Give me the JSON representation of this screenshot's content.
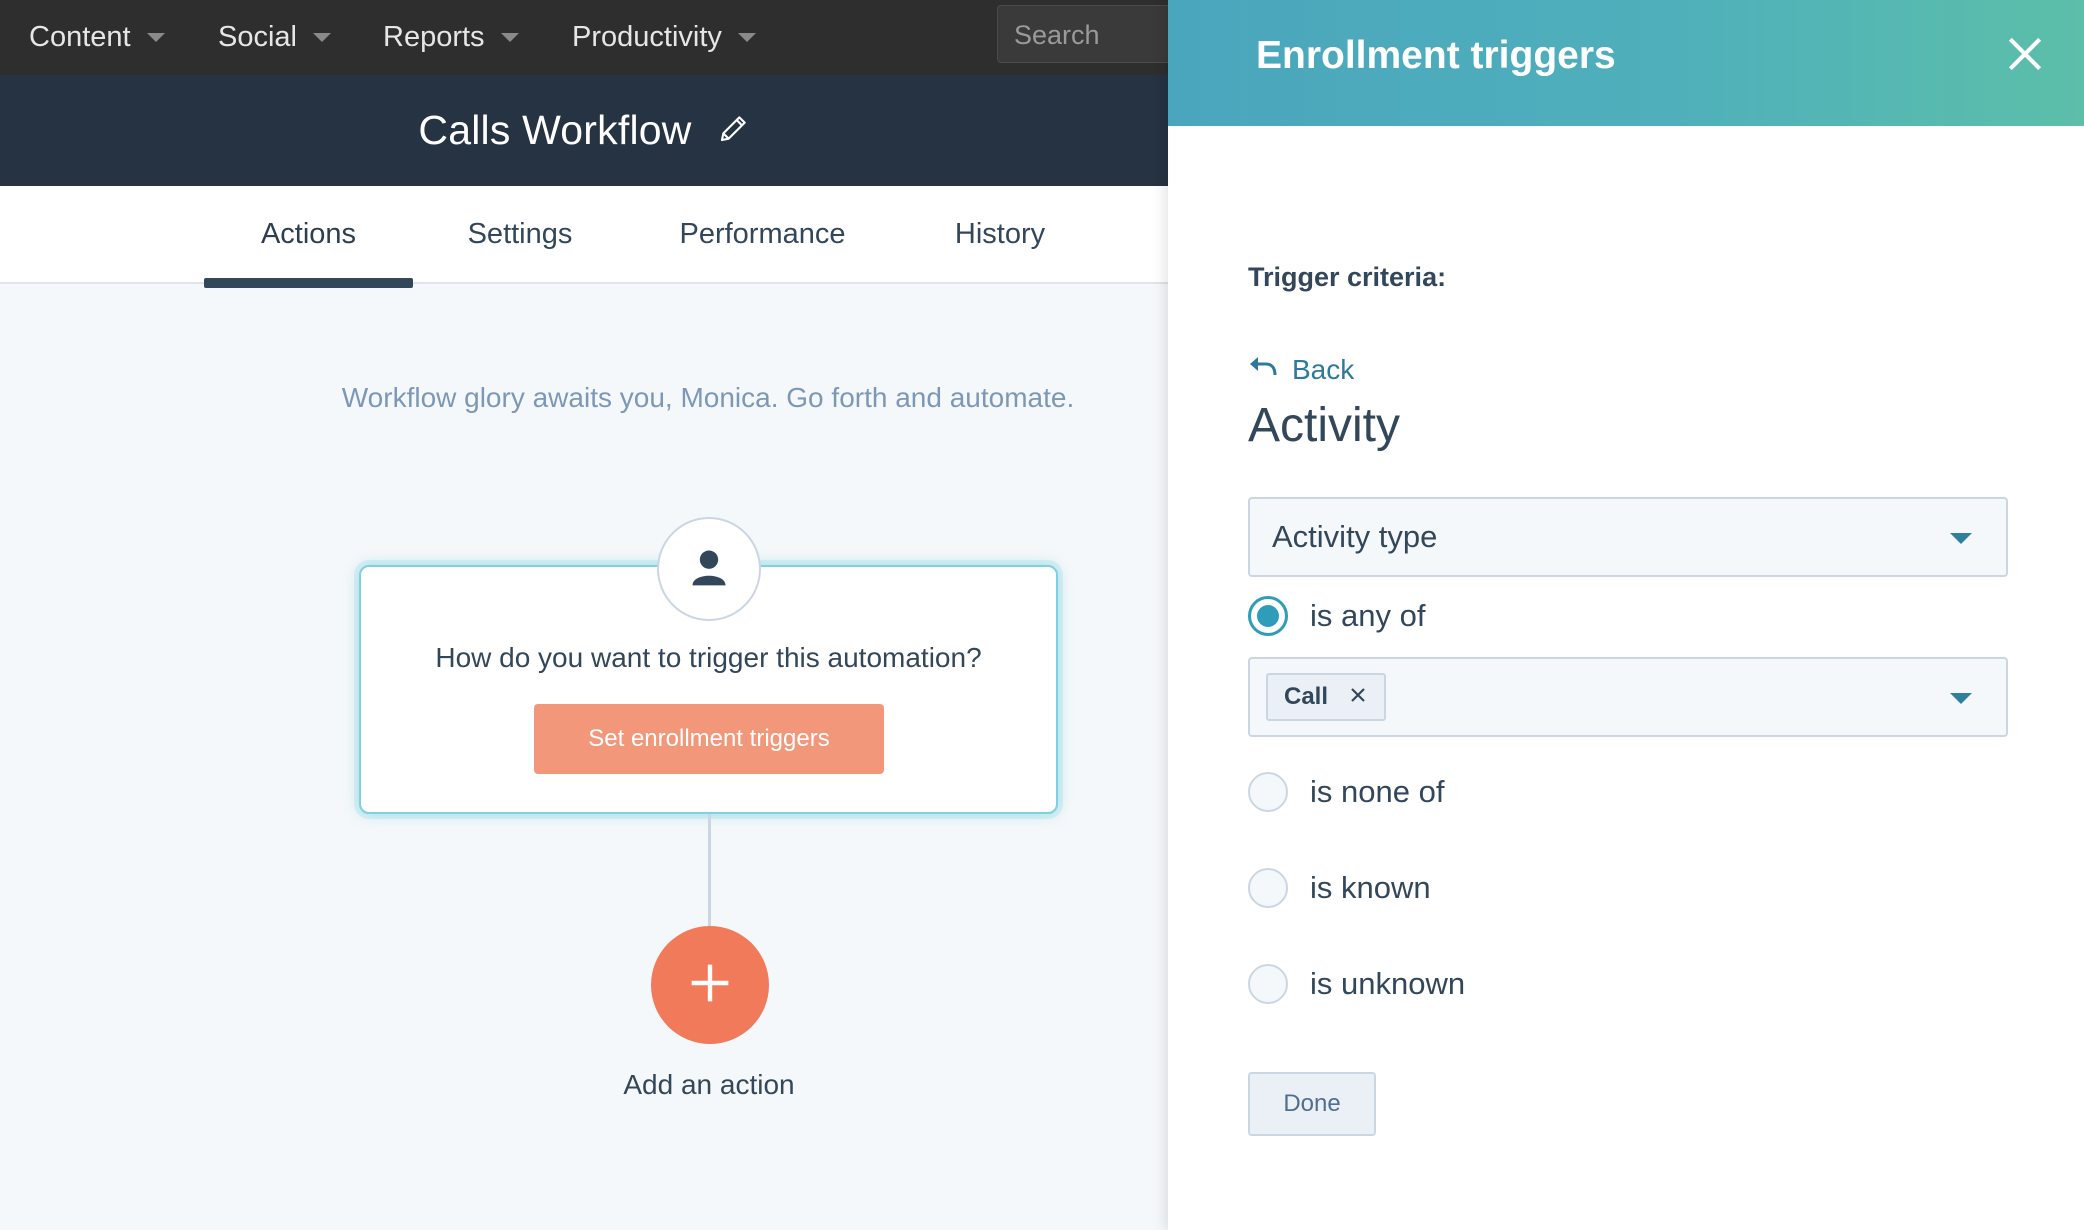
{
  "topnav": {
    "items": [
      {
        "label": "Content"
      },
      {
        "label": "Social"
      },
      {
        "label": "Reports"
      },
      {
        "label": "Productivity"
      }
    ],
    "search_placeholder": "Search"
  },
  "workflow": {
    "title": "Calls Workflow"
  },
  "tabs": [
    {
      "label": "Actions",
      "active": true
    },
    {
      "label": "Settings",
      "active": false
    },
    {
      "label": "Performance",
      "active": false
    },
    {
      "label": "History",
      "active": false
    }
  ],
  "canvas": {
    "greeting": "Workflow glory awaits you, Monica. Go forth and automate.",
    "trigger_question": "How do you want to trigger this automation?",
    "set_triggers_label": "Set enrollment triggers",
    "add_action_label": "Add an action"
  },
  "panel": {
    "title": "Enrollment triggers",
    "criteria_label": "Trigger criteria:",
    "back_label": "Back",
    "section_title": "Activity",
    "property_dropdown_value": "Activity type",
    "operators": [
      {
        "label": "is any of",
        "selected": true
      },
      {
        "label": "is none of",
        "selected": false
      },
      {
        "label": "is known",
        "selected": false
      },
      {
        "label": "is unknown",
        "selected": false
      }
    ],
    "selected_values": [
      "Call"
    ],
    "done_label": "Done"
  },
  "colors": {
    "nav_bg": "#2e2e2e",
    "header_bg": "#253342",
    "accent_orange": "#f07a5a",
    "button_orange": "#f2977a",
    "panel_teal": "#4aa6bd",
    "link_blue": "#2f7a9a"
  }
}
